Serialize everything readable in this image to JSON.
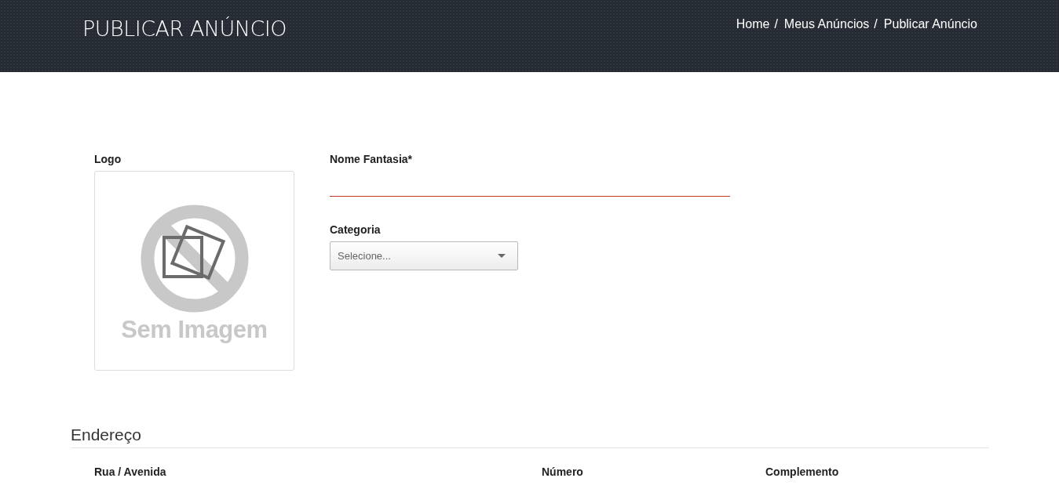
{
  "header": {
    "title": "PUBLICAR ANÚNCIO",
    "breadcrumb": {
      "separator": "/",
      "items": [
        "Home",
        "Meus Anúncios",
        "Publicar Anúncio"
      ]
    }
  },
  "logo": {
    "label": "Logo",
    "placeholder_text": "Sem Imagem"
  },
  "nome_fantasia": {
    "label": "Nome Fantasia*",
    "invalid": true
  },
  "categoria": {
    "label": "Categoria",
    "placeholder": "Selecione..."
  },
  "endereco": {
    "title": "Endereço",
    "fields": [
      "Rua / Avenida",
      "Número",
      "Complemento"
    ]
  }
}
